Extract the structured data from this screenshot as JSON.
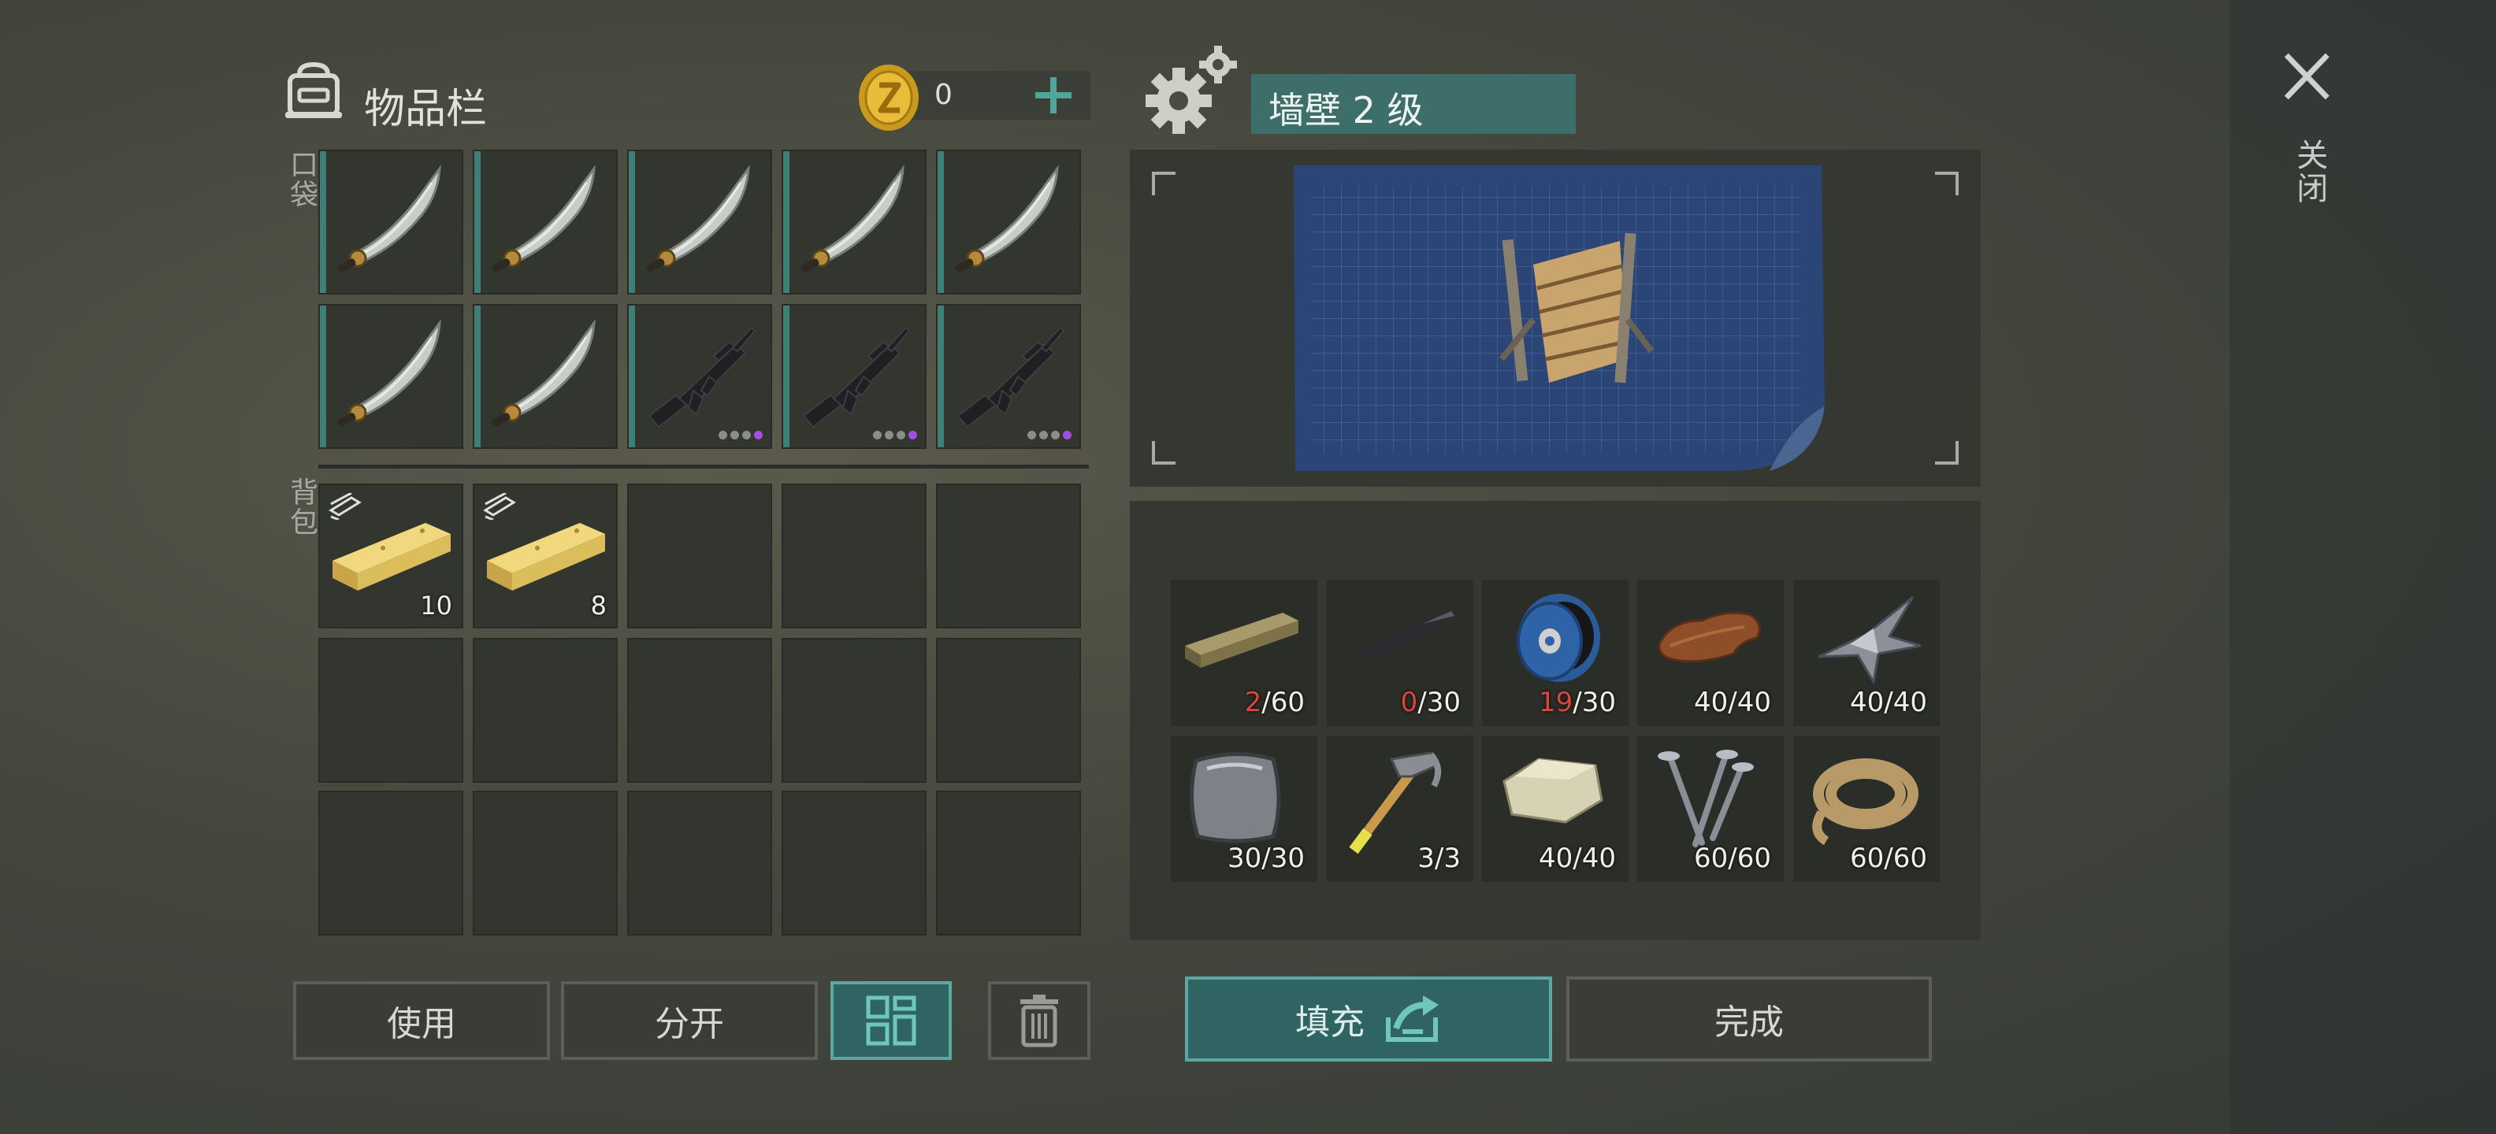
{
  "inventory": {
    "title": "物品栏",
    "coins": "0",
    "pocket_label": "口袋",
    "backpack_label": "背包",
    "pocket_slots": [
      "sword",
      "sword",
      "sword",
      "sword",
      "sword",
      "sword",
      "sword",
      "rifle",
      "rifle",
      "rifle"
    ],
    "backpack_slots": [
      {
        "item": "plank",
        "count": "10"
      },
      {
        "item": "plank",
        "count": "8"
      }
    ]
  },
  "buttons": {
    "use": "使用",
    "split": "分开",
    "fill": "填充",
    "complete": "完成"
  },
  "build": {
    "title": "墙壁 2 级",
    "materials": [
      {
        "icon": "log-icon",
        "have": "2",
        "need": "/60",
        "short": true
      },
      {
        "icon": "metal-bar-icon",
        "have": "0",
        "need": "/30",
        "short": true
      },
      {
        "icon": "wire-spool-icon",
        "have": "19",
        "need": "/30",
        "short": true
      },
      {
        "icon": "leather-icon",
        "have": "40",
        "need": "/40",
        "short": false
      },
      {
        "icon": "scrap-metal-icon",
        "have": "40",
        "need": "/40",
        "short": false
      },
      {
        "icon": "metal-plate-icon",
        "have": "30",
        "need": "/30",
        "short": false
      },
      {
        "icon": "hammer-icon",
        "have": "3",
        "need": "/3",
        "short": false
      },
      {
        "icon": "stone-icon",
        "have": "40",
        "need": "/40",
        "short": false
      },
      {
        "icon": "nails-icon",
        "have": "60",
        "need": "/60",
        "short": false
      },
      {
        "icon": "rope-icon",
        "have": "60",
        "need": "/60",
        "short": false
      }
    ]
  },
  "close_label": "关闭",
  "colors": {
    "accent": "#3f7f78",
    "shortage": "#d9463c",
    "rarity_purple": "#a050e0"
  }
}
